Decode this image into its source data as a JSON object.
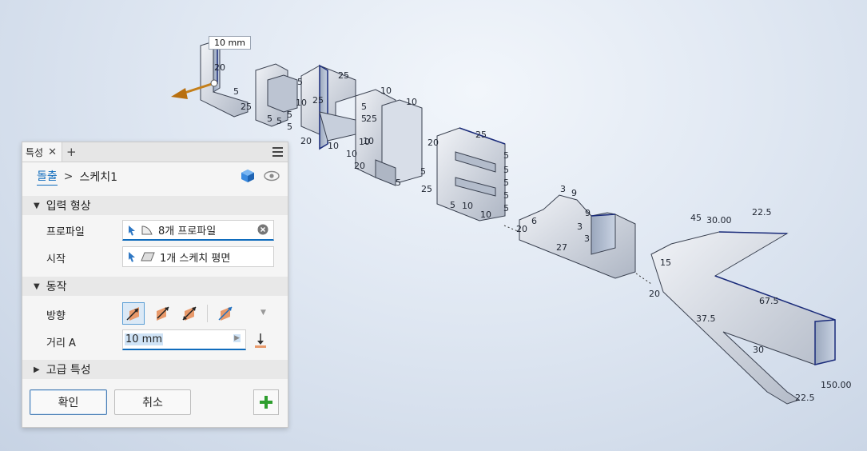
{
  "viewport": {
    "distance_label": "10 mm",
    "dimensions": [
      "20",
      "5",
      "25",
      "5",
      "5",
      "5",
      "10",
      "5",
      "25",
      "25",
      "5",
      "5",
      "10",
      "20",
      "10",
      "10",
      "10",
      "5",
      "25",
      "10",
      "10",
      "20",
      "5",
      "20",
      "25",
      "5",
      "5",
      "5",
      "5",
      "5",
      "5",
      "5",
      "10",
      "25",
      "10",
      "3",
      "9",
      "3",
      "9",
      "6",
      "20",
      "3",
      "27",
      "15",
      "45",
      "30.00",
      "22.5",
      "20",
      "67.5",
      "37.5",
      "30",
      "150.00",
      "22.5"
    ]
  },
  "panel": {
    "tab_label": "특성",
    "close_glyph": "✕",
    "add_glyph": "+",
    "breadcrumb": {
      "feature": "돌출",
      "separator": ">",
      "sketch": "스케치1"
    },
    "sections": {
      "input": "입력 형상",
      "behavior": "동작",
      "advanced": "고급 특성"
    },
    "fields": {
      "profile_label": "프로파일",
      "profile_value": "8개 프로파일",
      "start_label": "시작",
      "start_value": "1개 스케치 평면",
      "direction_label": "방향",
      "distance_label": "거리 A",
      "distance_value": "10 mm"
    },
    "buttons": {
      "ok": "확인",
      "cancel": "취소"
    },
    "colors": {
      "accent": "#0f6cbd",
      "plus_green": "#2e9e2e",
      "direction_icon": "#e8996a"
    }
  }
}
